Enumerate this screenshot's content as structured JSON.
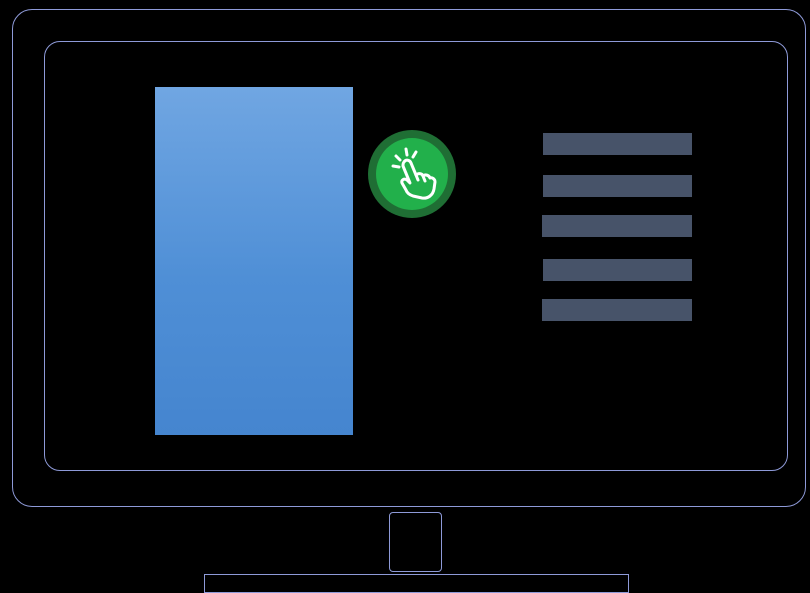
{
  "illustration": {
    "icons": {
      "touch": "hand-tap-icon"
    },
    "colors": {
      "background": "#000000",
      "outline": "#8e9ad8",
      "panel": "#5a97da",
      "badge": "#22b04b",
      "menu_line": "#475369"
    },
    "menu_line_count": 5
  }
}
